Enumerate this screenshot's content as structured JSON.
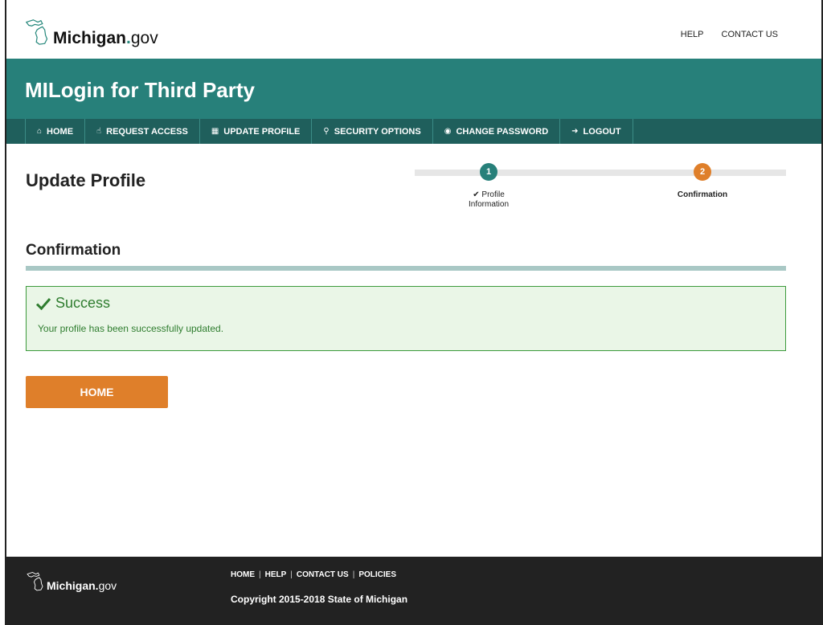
{
  "header": {
    "logo": {
      "brand": "Michigan",
      "dot": ".",
      "suffix": "gov"
    },
    "links": [
      "HELP",
      "CONTACT US"
    ]
  },
  "banner": {
    "title": "MILogin for Third Party"
  },
  "nav": {
    "items": [
      {
        "label": "HOME",
        "icon": "home-icon"
      },
      {
        "label": "REQUEST ACCESS",
        "icon": "hand-pointer-icon"
      },
      {
        "label": "UPDATE PROFILE",
        "icon": "id-card-icon"
      },
      {
        "label": "SECURITY OPTIONS",
        "icon": "key-icon"
      },
      {
        "label": "CHANGE PASSWORD",
        "icon": "lock-icon"
      },
      {
        "label": "LOGOUT",
        "icon": "sign-out-icon"
      }
    ]
  },
  "page": {
    "title": "Update Profile"
  },
  "stepper": {
    "steps": [
      {
        "number": "1",
        "label_line1": "Profile",
        "label_line2": "Information",
        "status": "complete"
      },
      {
        "number": "2",
        "label_line1": "Confirmation",
        "label_line2": "",
        "status": "current"
      }
    ]
  },
  "confirmation": {
    "title": "Confirmation",
    "alert_title": "Success",
    "alert_message": "Your profile has been successfully updated.",
    "home_button": "HOME"
  },
  "footer": {
    "logo": {
      "brand": "Michigan",
      "dot": ".",
      "suffix": "gov"
    },
    "links": [
      "HOME",
      "HELP",
      "CONTACT US",
      "POLICIES"
    ],
    "copyright": "Copyright 2015-2018 State of Michigan"
  },
  "colors": {
    "teal": "#27807a",
    "dark_teal": "#1f5f5c",
    "orange": "#df7f2a",
    "success_green": "#2f7d2f",
    "footer_bg": "#222222"
  }
}
